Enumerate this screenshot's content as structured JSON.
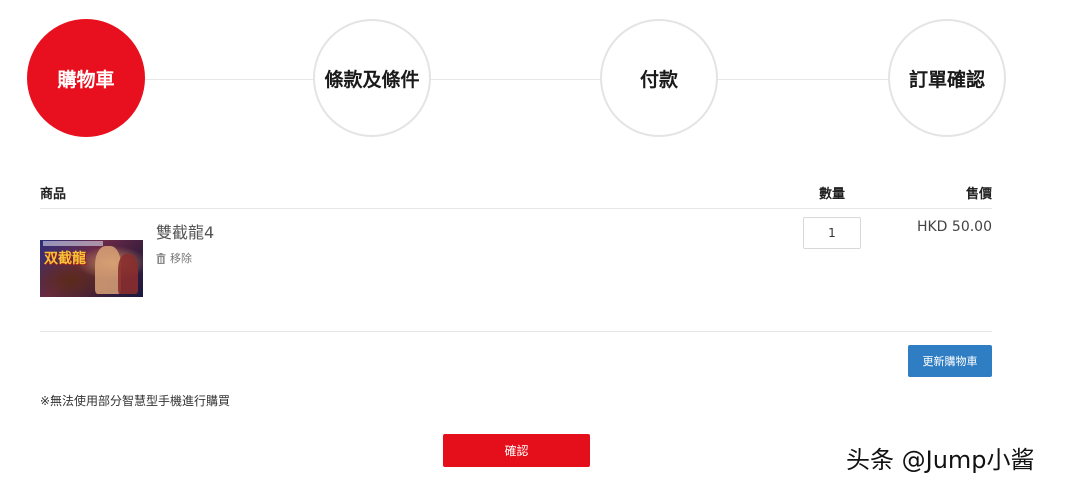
{
  "stepper": {
    "steps": [
      {
        "label": "購物車",
        "active": true
      },
      {
        "label": "條款及條件",
        "active": false
      },
      {
        "label": "付款",
        "active": false
      },
      {
        "label": "訂單確認",
        "active": false
      }
    ]
  },
  "cart": {
    "headers": {
      "product": "商品",
      "quantity": "數量",
      "price": "售價"
    },
    "items": [
      {
        "thumbnail_text": "双截龍",
        "name": "雙截龍4",
        "remove_label": "移除",
        "quantity": "1",
        "price": "HKD 50.00"
      }
    ],
    "update_button": "更新購物車"
  },
  "notice": "※無法使用部分智慧型手機進行購買",
  "confirm_button": "確認",
  "watermark": "头条 @Jump小酱",
  "colors": {
    "accent_red": "#e8101e",
    "update_blue": "#2f7dc2"
  }
}
